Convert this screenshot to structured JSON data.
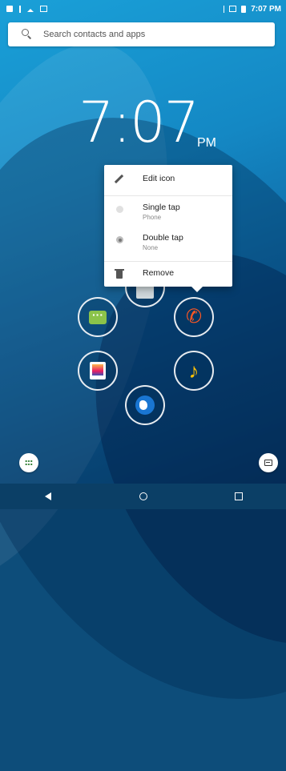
{
  "status_bar": {
    "time": "7:07 PM"
  },
  "search": {
    "placeholder": "Search contacts and apps"
  },
  "clock": {
    "time": "7:07",
    "ampm": "PM"
  },
  "menu": {
    "edit_icon_label": "Edit icon",
    "single_tap_label": "Single tap",
    "single_tap_value": "Phone",
    "double_tap_label": "Double tap",
    "double_tap_value": "None",
    "remove_label": "Remove"
  },
  "apps": [
    "messages",
    "gallery",
    "phone",
    "photos",
    "music",
    "browser"
  ],
  "colors": {
    "msg_green": "#8bc34a",
    "phone_orange": "#ff5722",
    "music_yellow": "#ffc107"
  }
}
